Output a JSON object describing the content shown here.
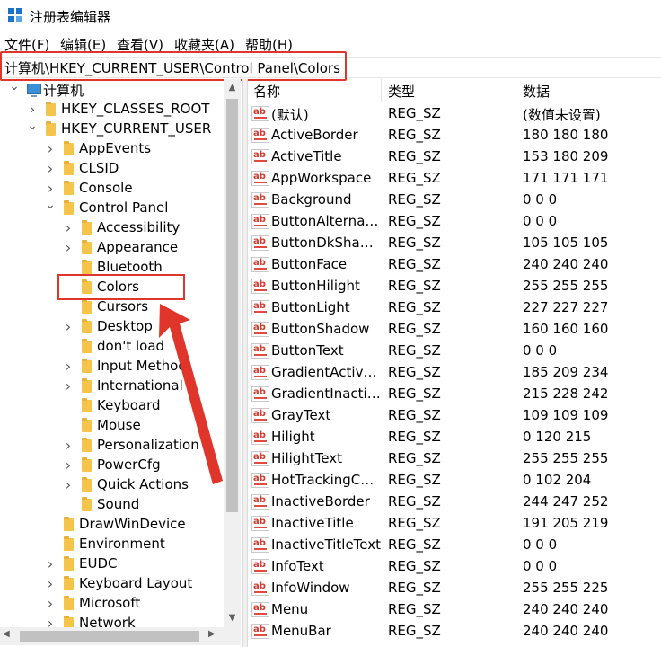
{
  "window": {
    "title": "注册表编辑器"
  },
  "menu": [
    {
      "label": "文件(F)",
      "name": "menu-file"
    },
    {
      "label": "编辑(E)",
      "name": "menu-edit"
    },
    {
      "label": "查看(V)",
      "name": "menu-view"
    },
    {
      "label": "收藏夹(A)",
      "name": "menu-favorites"
    },
    {
      "label": "帮助(H)",
      "name": "menu-help"
    }
  ],
  "address": {
    "path": "计算机\\HKEY_CURRENT_USER\\Control Panel\\Colors"
  },
  "tree": [
    {
      "label": "计算机",
      "level": 0,
      "arrow": "expanded",
      "icon": "computer-icon"
    },
    {
      "label": "HKEY_CLASSES_ROOT",
      "level": 1,
      "arrow": "collapsed"
    },
    {
      "label": "HKEY_CURRENT_USER",
      "level": 1,
      "arrow": "expanded"
    },
    {
      "label": "AppEvents",
      "level": 2,
      "arrow": "collapsed"
    },
    {
      "label": "CLSID",
      "level": 2,
      "arrow": "collapsed"
    },
    {
      "label": "Console",
      "level": 2,
      "arrow": "collapsed"
    },
    {
      "label": "Control Panel",
      "level": 2,
      "arrow": "expanded"
    },
    {
      "label": "Accessibility",
      "level": 3,
      "arrow": "collapsed"
    },
    {
      "label": "Appearance",
      "level": 3,
      "arrow": "collapsed"
    },
    {
      "label": "Bluetooth",
      "level": 3,
      "arrow": "none"
    },
    {
      "label": "Colors",
      "level": 3,
      "arrow": "none",
      "selected": true
    },
    {
      "label": "Cursors",
      "level": 3,
      "arrow": "none"
    },
    {
      "label": "Desktop",
      "level": 3,
      "arrow": "collapsed"
    },
    {
      "label": "don't load",
      "level": 3,
      "arrow": "none"
    },
    {
      "label": "Input Method",
      "level": 3,
      "arrow": "collapsed"
    },
    {
      "label": "International",
      "level": 3,
      "arrow": "collapsed"
    },
    {
      "label": "Keyboard",
      "level": 3,
      "arrow": "none"
    },
    {
      "label": "Mouse",
      "level": 3,
      "arrow": "none"
    },
    {
      "label": "Personalization",
      "level": 3,
      "arrow": "collapsed"
    },
    {
      "label": "PowerCfg",
      "level": 3,
      "arrow": "collapsed"
    },
    {
      "label": "Quick Actions",
      "level": 3,
      "arrow": "collapsed"
    },
    {
      "label": "Sound",
      "level": 3,
      "arrow": "none"
    },
    {
      "label": "DrawWinDevice",
      "level": 2,
      "arrow": "none"
    },
    {
      "label": "Environment",
      "level": 2,
      "arrow": "none"
    },
    {
      "label": "EUDC",
      "level": 2,
      "arrow": "collapsed"
    },
    {
      "label": "Keyboard Layout",
      "level": 2,
      "arrow": "collapsed"
    },
    {
      "label": "Microsoft",
      "level": 2,
      "arrow": "collapsed"
    },
    {
      "label": "Network",
      "level": 2,
      "arrow": "collapsed"
    }
  ],
  "columns": {
    "name": "名称",
    "type": "类型",
    "data": "数据"
  },
  "values": [
    {
      "name": "(默认)",
      "type": "REG_SZ",
      "data": "(数值未设置)"
    },
    {
      "name": "ActiveBorder",
      "type": "REG_SZ",
      "data": "180 180 180"
    },
    {
      "name": "ActiveTitle",
      "type": "REG_SZ",
      "data": "153 180 209"
    },
    {
      "name": "AppWorkspace",
      "type": "REG_SZ",
      "data": "171 171 171"
    },
    {
      "name": "Background",
      "type": "REG_SZ",
      "data": "0 0 0"
    },
    {
      "name": "ButtonAlternateFace",
      "type": "REG_SZ",
      "data": "0 0 0"
    },
    {
      "name": "ButtonDkShadow",
      "type": "REG_SZ",
      "data": "105 105 105"
    },
    {
      "name": "ButtonFace",
      "type": "REG_SZ",
      "data": "240 240 240"
    },
    {
      "name": "ButtonHilight",
      "type": "REG_SZ",
      "data": "255 255 255"
    },
    {
      "name": "ButtonLight",
      "type": "REG_SZ",
      "data": "227 227 227"
    },
    {
      "name": "ButtonShadow",
      "type": "REG_SZ",
      "data": "160 160 160"
    },
    {
      "name": "ButtonText",
      "type": "REG_SZ",
      "data": "0 0 0"
    },
    {
      "name": "GradientActiveTitle",
      "type": "REG_SZ",
      "data": "185 209 234"
    },
    {
      "name": "GradientInactiveTitle",
      "type": "REG_SZ",
      "data": "215 228 242"
    },
    {
      "name": "GrayText",
      "type": "REG_SZ",
      "data": "109 109 109"
    },
    {
      "name": "Hilight",
      "type": "REG_SZ",
      "data": "0 120 215"
    },
    {
      "name": "HilightText",
      "type": "REG_SZ",
      "data": "255 255 255"
    },
    {
      "name": "HotTrackingColor",
      "type": "REG_SZ",
      "data": "0 102 204"
    },
    {
      "name": "InactiveBorder",
      "type": "REG_SZ",
      "data": "244 247 252"
    },
    {
      "name": "InactiveTitle",
      "type": "REG_SZ",
      "data": "191 205 219"
    },
    {
      "name": "InactiveTitleText",
      "type": "REG_SZ",
      "data": "0 0 0"
    },
    {
      "name": "InfoText",
      "type": "REG_SZ",
      "data": "0 0 0"
    },
    {
      "name": "InfoWindow",
      "type": "REG_SZ",
      "data": "255 255 225"
    },
    {
      "name": "Menu",
      "type": "REG_SZ",
      "data": "240 240 240"
    },
    {
      "name": "MenuBar",
      "type": "REG_SZ",
      "data": "240 240 240"
    }
  ],
  "colors": {
    "annotation": "#e0352b",
    "folder": "#f4c44b",
    "icon_blue": "#1a73c8"
  }
}
